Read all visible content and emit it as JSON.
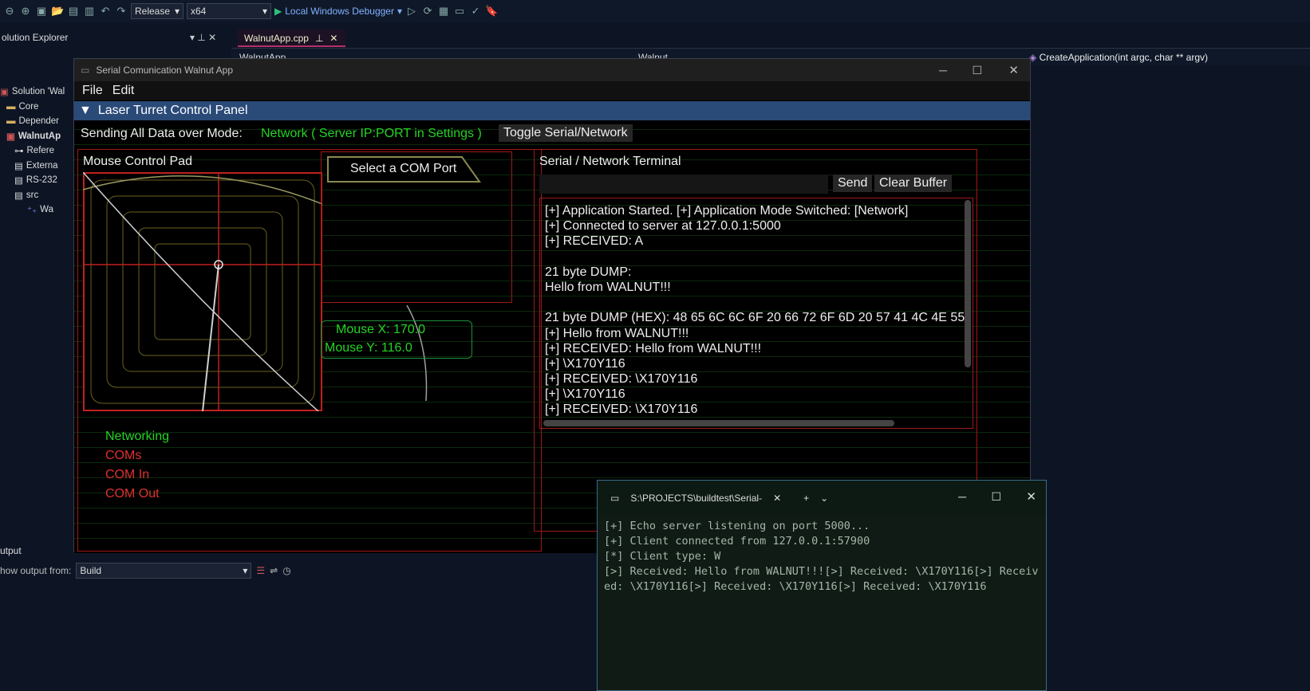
{
  "toolbar": {
    "config": "Release",
    "platform": "x64",
    "debugger": "Local Windows Debugger"
  },
  "solution_explorer": {
    "title": "olution Explorer",
    "items": [
      "Solution 'Wal",
      "Core",
      "Depender",
      "WalnutAp",
      "Refere",
      "Externa",
      "RS-232",
      "src",
      "Wa"
    ]
  },
  "editor": {
    "tab": "WalnutApp.cpp",
    "nav_left": "WalnutApp",
    "nav_mid": "Walnut",
    "nav_right": "CreateApplication(int argc, char ** argv)"
  },
  "app": {
    "title": "Serial Comunication Walnut App",
    "menu": [
      "File",
      "Edit"
    ],
    "panel_title": "Laser Turret Control Panel",
    "mode_label": "Sending All Data over Mode:",
    "mode_value": "Network ( Server IP:PORT in Settings )",
    "toggle_button": "Toggle Serial/Network",
    "mouse_pad_title": "Mouse Control Pad",
    "com_port_button": "Select a COM Port",
    "mouse_x": "Mouse X: 170.0",
    "mouse_y": "Mouse Y: 116.0",
    "legend": [
      {
        "label": "Networking",
        "color": "#25d325"
      },
      {
        "label": "COMs",
        "color": "#e03030"
      },
      {
        "label": "COM In",
        "color": "#e03030"
      },
      {
        "label": "COM Out",
        "color": "#e03030"
      }
    ],
    "terminal_title": "Serial / Network Terminal",
    "send_button": "Send",
    "clear_button": "Clear Buffer",
    "log": [
      "[+] Application Started. [+] Application Mode Switched: [Network]",
      "[+] Connected to server at 127.0.0.1:5000",
      "[+] RECEIVED: A",
      "",
      "21 byte DUMP:",
      "Hello from WALNUT!!!",
      "",
      "21 byte DUMP (HEX): 48 65 6C 6C 6F 20 66 72 6F 6D 20 57 41 4C 4E 55",
      "[+] Hello from WALNUT!!!",
      "[+] RECEIVED: Hello from WALNUT!!!",
      "[+] \\X170Y116",
      "[+] RECEIVED: \\X170Y116",
      "[+] \\X170Y116",
      "[+] RECEIVED: \\X170Y116"
    ]
  },
  "terminal": {
    "tab_title": "S:\\PROJECTS\\buildtest\\Serial-",
    "lines": "[+] Echo server listening on port 5000...\n[+] Client connected from 127.0.0.1:57900\n[*] Client type: W\n[>] Received: Hello from WALNUT!!![>] Received: \\X170Y116[>] Received: \\X170Y116[>] Received: \\X170Y116[>] Received: \\X170Y116"
  },
  "output": {
    "title": "utput",
    "show_from_label": "how output from:",
    "source": "Build"
  }
}
